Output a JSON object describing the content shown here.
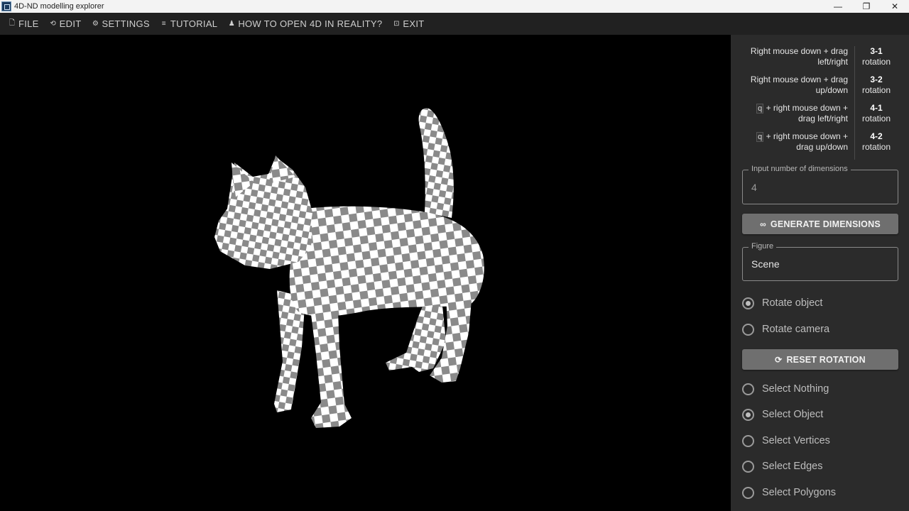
{
  "window": {
    "title": "4D-ND modelling explorer",
    "controls": [
      "—",
      "❐",
      "✕"
    ]
  },
  "menu": [
    {
      "label": "FILE",
      "icon": "file-icon",
      "glyph": "🗋"
    },
    {
      "label": "EDIT",
      "icon": "history-icon",
      "glyph": "⟲"
    },
    {
      "label": "SETTINGS",
      "icon": "gear-icon",
      "glyph": "⚙"
    },
    {
      "label": "TUTORIAL",
      "icon": "list-icon",
      "glyph": "≡"
    },
    {
      "label": "HOW TO OPEN 4D IN REALITY?",
      "icon": "person-icon",
      "glyph": "♟"
    },
    {
      "label": "EXIT",
      "icon": "exit-icon",
      "glyph": "⊡"
    }
  ],
  "help": [
    {
      "line1": "Right mouse down + drag",
      "line2": "left/right",
      "key": "",
      "rot": "3-1",
      "rot_label": "rotation"
    },
    {
      "line1": "Right mouse down + drag",
      "line2": "up/down",
      "key": "",
      "rot": "3-2",
      "rot_label": "rotation"
    },
    {
      "line1": "+ right mouse down +",
      "line2": "drag left/right",
      "key": "q",
      "rot": "4-1",
      "rot_label": "rotation"
    },
    {
      "line1": "+ right mouse down +",
      "line2": "drag up/down",
      "key": "q",
      "rot": "4-2",
      "rot_label": "rotation"
    }
  ],
  "dimensions_input": {
    "label": "Input number of dimensions",
    "value": "4"
  },
  "generate_button": {
    "label": "GENERATE DIMENSIONS",
    "icon": "infinity-icon",
    "glyph": "∞"
  },
  "figure_select": {
    "label": "Figure",
    "value": "Scene"
  },
  "rotate_mode": {
    "options": [
      {
        "label": "Rotate object",
        "checked": true
      },
      {
        "label": "Rotate camera",
        "checked": false
      }
    ]
  },
  "reset_button": {
    "label": "RESET ROTATION",
    "icon": "reset-icon",
    "glyph": "⟳"
  },
  "select_mode": {
    "options": [
      {
        "label": "Select Nothing",
        "checked": false
      },
      {
        "label": "Select Object",
        "checked": true
      },
      {
        "label": "Select Vertices",
        "checked": false
      },
      {
        "label": "Select Edges",
        "checked": false
      },
      {
        "label": "Select Polygons",
        "checked": false
      }
    ]
  },
  "colors": {
    "menubar": "#212121",
    "panel": "#2b2b2b",
    "viewport": "#000000",
    "checker_light": "#ffffff",
    "checker_dark": "#8a8a8a"
  }
}
